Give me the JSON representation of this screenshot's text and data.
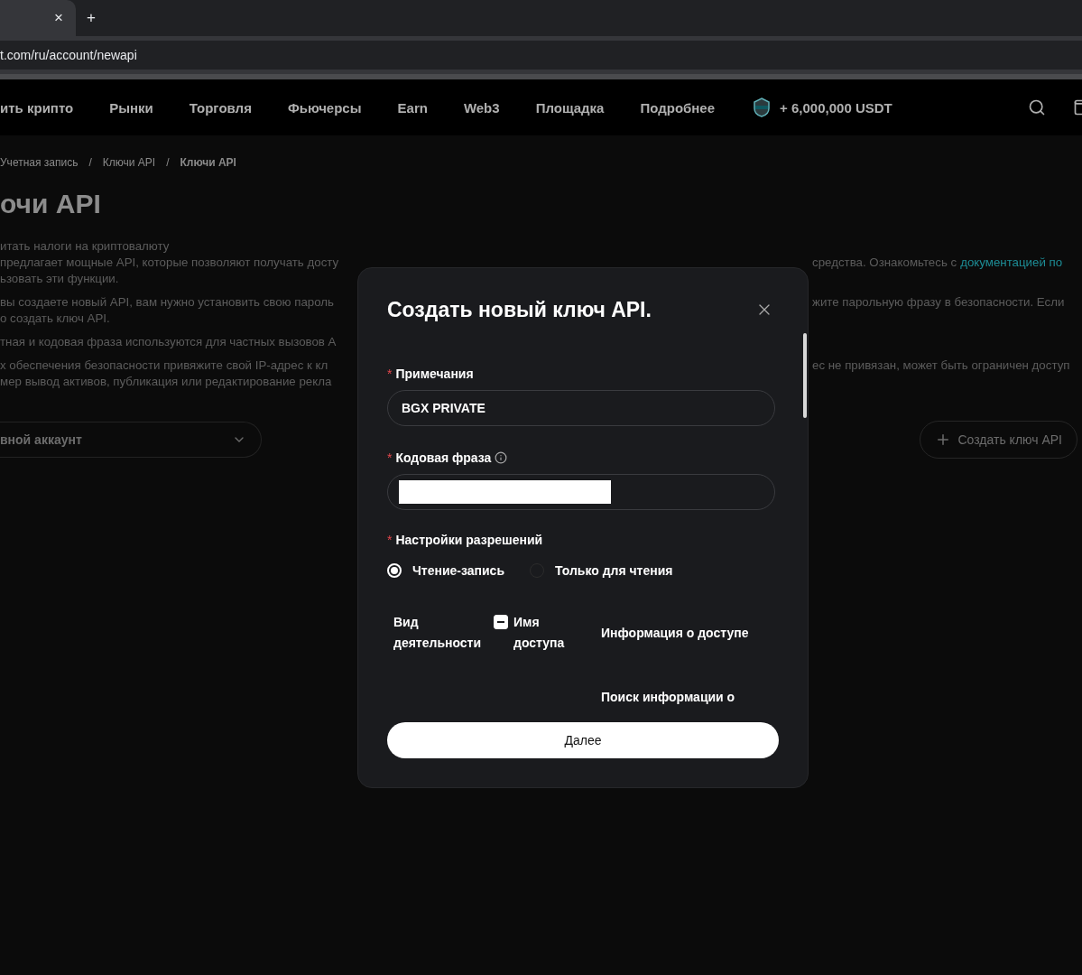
{
  "browser": {
    "tab_close": "×",
    "new_tab": "+",
    "url": "t.com/ru/account/newapi"
  },
  "nav": {
    "items": [
      "ить крипто",
      "Рынки",
      "Торговля",
      "Фьючерсы",
      "Earn",
      "Web3",
      "Площадка",
      "Подробнее"
    ],
    "promo": "+ 6,000,000 USDT"
  },
  "breadcrumb": [
    {
      "label": "Учетная запись",
      "current": false
    },
    {
      "separator": "/",
      "label": "Ключи API",
      "current": false
    },
    {
      "separator": "/",
      "label": "Ключи API",
      "current": true
    }
  ],
  "title": "очи API",
  "description": [
    [
      {
        "left": "итать налоги на криптовалюту"
      },
      {
        "left": "предлагает мощные API, которые позволяют получать досту",
        "right": "средства. Ознакомьтесь с",
        "link": "документацией по"
      },
      {
        "left": "ьзовать эти функции."
      }
    ],
    [
      {
        "left": "вы создаете новый API, вам нужно установить свою пароль",
        "right": "жите парольную фразу в безопасности. Если"
      },
      {
        "left": "о создать ключ API."
      }
    ],
    [
      {
        "left": "тная и кодовая фраза используются для частных вызовов А"
      }
    ],
    [
      {
        "left": "х обеспечения безопасности привяжите свой IP-адрес к кл",
        "right": "ес не привязан, может быть ограничен доступ"
      },
      {
        "left": "мер вывод активов, публикация или редактирование рекла"
      }
    ]
  ],
  "account_select": {
    "value": "вной аккаунт"
  },
  "create_button": {
    "label": "Создать ключ API"
  },
  "modal": {
    "title": "Создать новый ключ API.",
    "fields": [
      {
        "kind": "text",
        "mark": "*",
        "label": "Примечания",
        "value": "BGX PRIVATE"
      },
      {
        "kind": "redacted",
        "mark": "*",
        "label": "Кодовая фраза",
        "info": true
      }
    ],
    "permissions": {
      "mark": "*",
      "label": "Настройки разрешений",
      "options": [
        {
          "label": "Чтение-запись",
          "selected": true
        },
        {
          "label": "Только для чтения",
          "selected": false
        }
      ]
    },
    "table": {
      "columns": [
        "Вид деятельности",
        "Имя доступа",
        "Информация о доступе"
      ],
      "select_all_indeterminate": true,
      "rows": [
        {
          "access_info": "Поиск информации о"
        }
      ]
    },
    "next_button": "Далее"
  }
}
